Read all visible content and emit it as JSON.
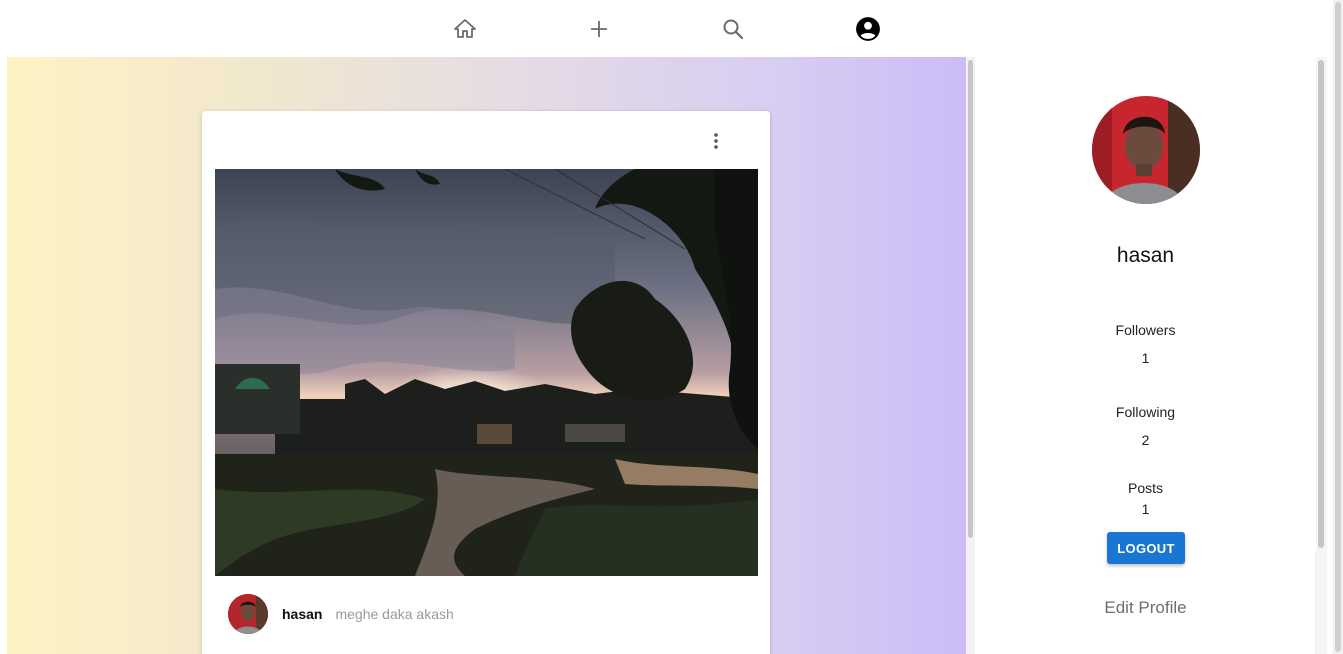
{
  "nav": {
    "home_icon": "home-icon",
    "add_icon": "plus-icon",
    "search_icon": "search-icon",
    "profile_icon": "account-circle-icon"
  },
  "post": {
    "menu_icon": "more-vert-icon",
    "username": "hasan",
    "caption": "meghe daka akash"
  },
  "profile": {
    "username": "hasan",
    "followers_label": "Followers",
    "followers_count": "1",
    "following_label": "Following",
    "following_count": "2",
    "posts_label": "Posts",
    "posts_count": "1",
    "logout_label": "LOGOUT",
    "edit_profile_label": "Edit Profile"
  },
  "colors": {
    "accent": "#1976d2",
    "gradient_start": "#fdf3c4",
    "gradient_end": "#cbbcf7"
  }
}
